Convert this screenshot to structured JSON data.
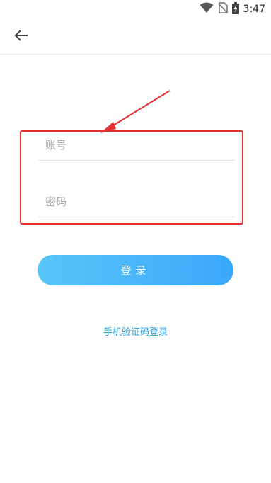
{
  "status_bar": {
    "time": "3:47",
    "icons": [
      "wifi-icon",
      "no-sim-icon",
      "battery-charging-icon"
    ]
  },
  "app_bar": {
    "back_icon": "arrow-left-icon"
  },
  "form": {
    "account_placeholder": "账号",
    "account_value": "",
    "password_placeholder": "密码",
    "password_value": ""
  },
  "login_button": {
    "label": "登录"
  },
  "sms_login": {
    "label": "手机验证码登录"
  },
  "colors": {
    "annotation": "#e63030",
    "button_start": "#58c6f8",
    "button_end": "#3aa8fb",
    "link": "#2a9ad6"
  }
}
